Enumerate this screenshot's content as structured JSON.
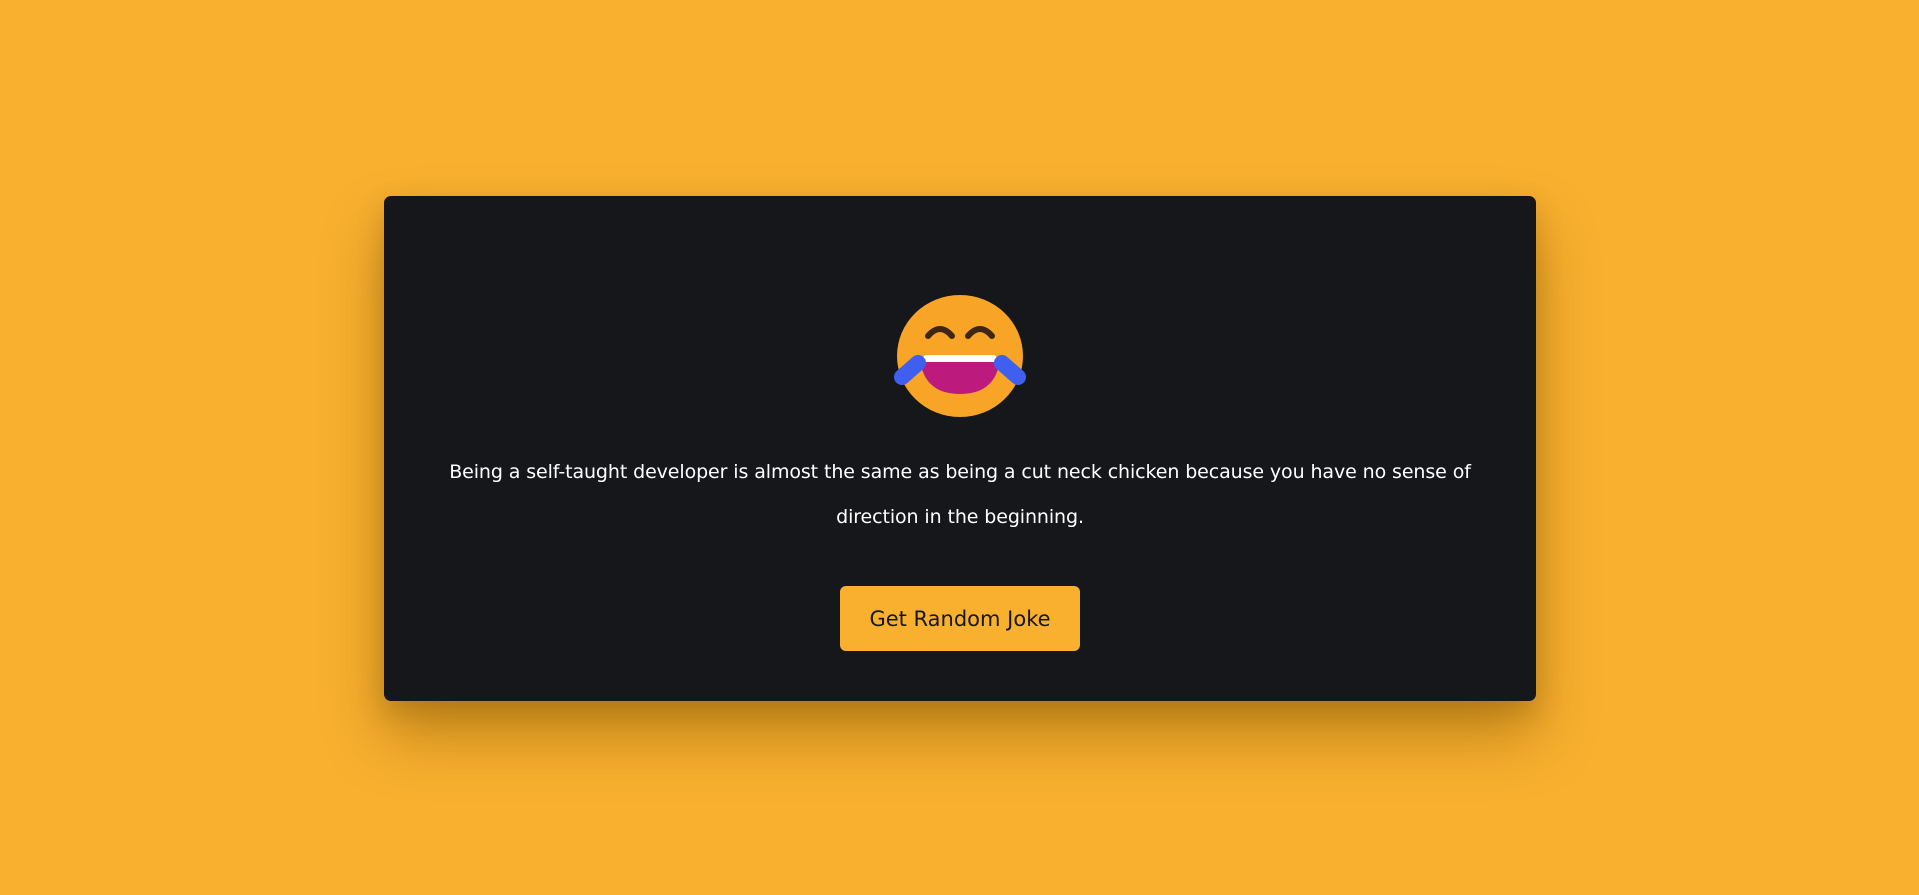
{
  "page": {
    "background_color": "#f9b02f"
  },
  "card": {
    "background_color": "#16171b",
    "emoji_icon": "face-with-tears-of-joy-icon",
    "joke_text": "Being a self-taught developer is almost the same as being a cut neck chicken because you have no sense of direction in the beginning.",
    "button_label": "Get Random Joke",
    "button_color": "#f9b02f"
  }
}
